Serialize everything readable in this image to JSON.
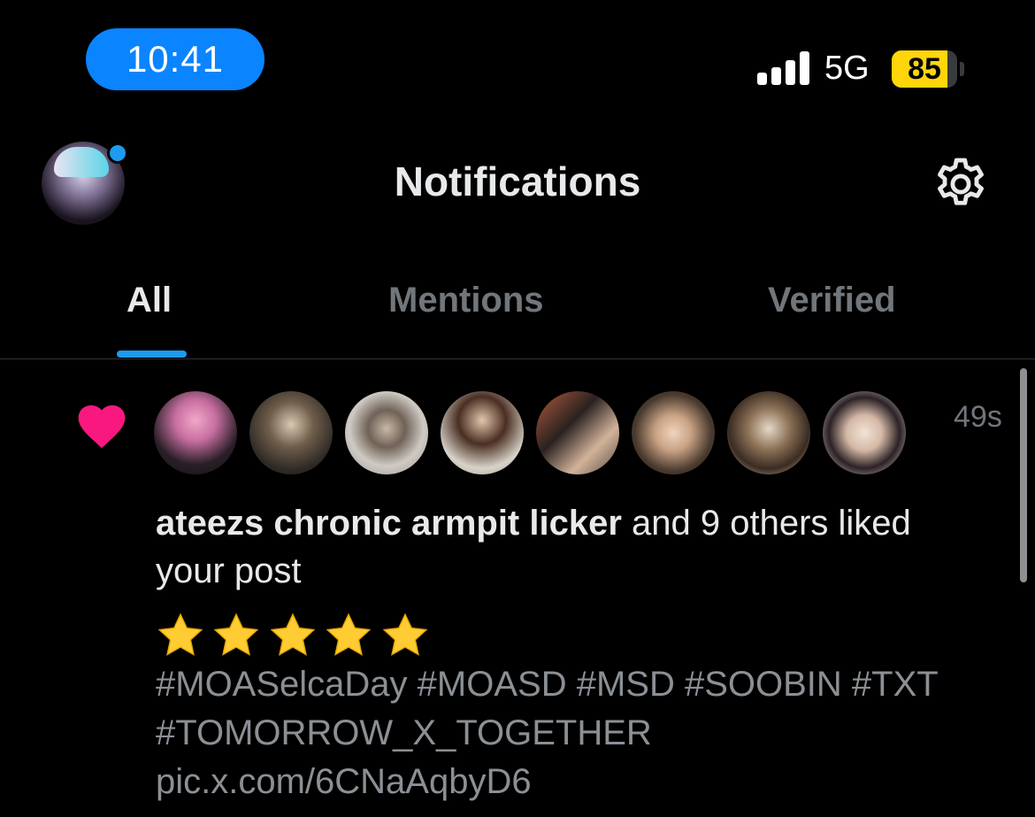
{
  "status_bar": {
    "time": "10:41",
    "network": "5G",
    "battery_level": "85",
    "signal_icon": "cellular-signal-icon",
    "colors": {
      "time_pill": "#0a84ff",
      "battery": "#ffd60a"
    }
  },
  "header": {
    "title": "Notifications",
    "settings_icon": "gear-icon",
    "profile_icon": "avatar"
  },
  "tabs": [
    {
      "label": "All",
      "selected": true
    },
    {
      "label": "Mentions",
      "selected": false
    },
    {
      "label": "Verified",
      "selected": false
    }
  ],
  "notification": {
    "type_icon": "heart-icon",
    "timestamp": "49s",
    "user_name": "ateezs chronic armpit licker",
    "action_text": " and 9 others liked your post",
    "avatar_count": 8,
    "stars_rating": 5,
    "post_text": "#MOASelcaDay #MOASD #MSD #SOOBIN #TXT #TOMORROW_X_TOGETHER pic.x.com/6CNaAqbyD6",
    "colors": {
      "heart": "#f91880",
      "accent": "#1d9bf0"
    }
  }
}
